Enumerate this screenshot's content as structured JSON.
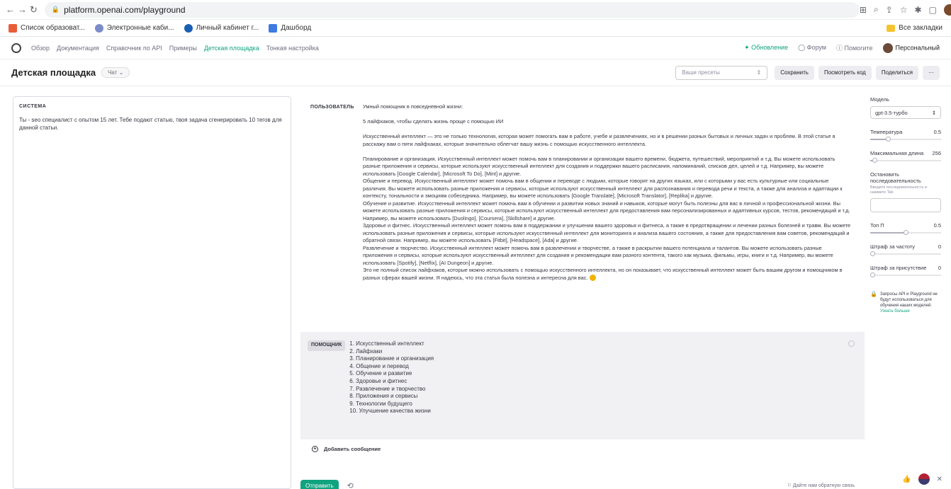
{
  "browser": {
    "url": "platform.openai.com/playground",
    "bookmarks": [
      {
        "label": "Список образоват..."
      },
      {
        "label": "Электронные каби..."
      },
      {
        "label": "Личный кабинет г..."
      },
      {
        "label": "Дашборд"
      }
    ],
    "all_bookmarks": "Все закладки"
  },
  "topnav": {
    "items": [
      "Обзор",
      "Документация",
      "Справочник по API",
      "Примеры",
      "Детская площадка",
      "Тонкая настройка"
    ],
    "update": "Обновление",
    "forum": "Форум",
    "help": "Помогите",
    "account": "Персональный"
  },
  "header": {
    "title": "Детская площадка",
    "mode": "Чат",
    "preset_placeholder": "Ваши пресеты",
    "save": "Сохранить",
    "view_code": "Посмотреть код",
    "share": "Поделиться",
    "more": "···"
  },
  "system": {
    "label": "СИСТЕМА",
    "text": "Ты - seo специалист с опытом 15 лет. Тебе подают статью, твоя задача сгенерировать 10 тегов для данной статьи."
  },
  "user_message": {
    "role": "ПОЛЬЗОВАТЕЛЬ",
    "paragraphs": [
      "Умный помощник в повседневной жизни:",
      "5 лайфхаков, чтобы сделать жизнь проще с помощью ИИ",
      "Искусственный интеллект — это не только технология, которая может помогать вам в работе, учебе и развлечениях, но и в решении разных бытовых и личных задач и проблем. В этой статье я расскажу вам о пяти лайфхаках, которые значительно облегчат вашу жизнь с помощью искусственного интеллекта.",
      "Планирование и организация. Искусственный интеллект может помочь вам в планировании и организации вашего времени, бюджета, путешествий, мероприятий и т.д. Вы можете использовать разные приложения и сервисы, которые используют искусственный интеллект для создания и поддержки вашего расписания, напоминаний, списков дел, целей и т.д. Например, вы можете использовать [Google Calendar], [Microsoft To Do], [Mint] и другие.",
      "Общение и перевод. Искусственный интеллект может помочь вам в общении и переводе с людьми, которые говорят на других языках, или с которыми у вас есть культурные или социальные различия. Вы можете использовать разные приложения и сервисы, которые используют искусственный интеллект для распознавания и перевода речи и текста, а также для анализа и адаптации к контексту, тональности и эмоциям собеседника. Например, вы можете использовать [Google Translate], [Microsoft Translator], [Replika] и другие.",
      "Обучение и развитие. Искусственный интеллект может помочь вам в обучении и развитии новых знаний и навыков, которые могут быть полезны для вас в личной и профессиональной жизни. Вы можете использовать разные приложения и сервисы, которые используют искусственный интеллект для предоставления вам персонализированных и адаптивных курсов, тестов, рекомендаций и т.д. Например, вы можете использовать [Duolingo], [Coursera], [Skillshare] и другие.",
      "Здоровье и фитнес. Искусственный интеллект может помочь вам в поддержании и улучшении вашего здоровья и фитнеса, а также в предотвращении и лечении разных болезней и травм. Вы можете использовать разные приложения и сервисы, которые используют искусственный интеллект для мониторинга и анализа вашего состояния, а также для предоставления вам советов, рекомендаций и обратной связи. Например, вы можете использовать [Fitbit], [Headspace], [Ada] и другие.",
      "Развлечение и творчество. Искусственный интеллект может помочь вам в развлечении и творчестве, а также в раскрытии вашего потенциала и талантов. Вы можете использовать разные приложения и сервисы, которые используют искусственный интеллект для создания и рекомендации вам разного контента, такого как музыка, фильмы, игры, книги и т.д. Например, вы можете использовать [Spotify], [Netflix], [AI Dungeon] и другие.",
      "Это не полный список лайфхаков, которые можно использовать с помощью искусственного интеллекта, но он показывает, что искусственный интеллект может быть вашим другом и помощником в разных сферах вашей жизни. Я надеюсь, что эта статья была полезна и интересна для вас."
    ]
  },
  "assistant_message": {
    "role": "ПОМОЩНИК",
    "items": [
      "1. Искусственный интеллект",
      "2. Лайфхаки",
      "3. Планирование и организация",
      "4. Общение и перевод",
      "5. Обучение и развитие",
      "6. Здоровье и фитнес",
      "7. Развлечение и творчество",
      "8. Приложения и сервисы",
      "9. Технологии будущего",
      "10. Улучшение качества жизни"
    ]
  },
  "chat": {
    "add_message": "Добавить сообщение",
    "submit": "Отправить",
    "feedback": "Дайте нам обратную связь"
  },
  "settings": {
    "model_label": "Модель",
    "model_value": "gpt-3.5-турбо",
    "temperature_label": "Температура",
    "temperature_value": "0.5",
    "temperature_fraction": 0.25,
    "max_length_label": "Максимальная длина",
    "max_length_value": "256",
    "max_length_fraction": 0.06,
    "stop_label": "Остановить последовательность",
    "stop_hint": "Введите последовательность и нажмите Tab",
    "top_p_label": "Топ П",
    "top_p_value": "0.5",
    "top_p_fraction": 0.5,
    "freq_label": "Штраф за частоту",
    "freq_value": "0",
    "presence_label": "Штраф за присутствие",
    "presence_value": "0",
    "note": "Запросы API и Playground не будут использоваться для обучения наших моделей.",
    "learn_more": "Узнать больше"
  }
}
